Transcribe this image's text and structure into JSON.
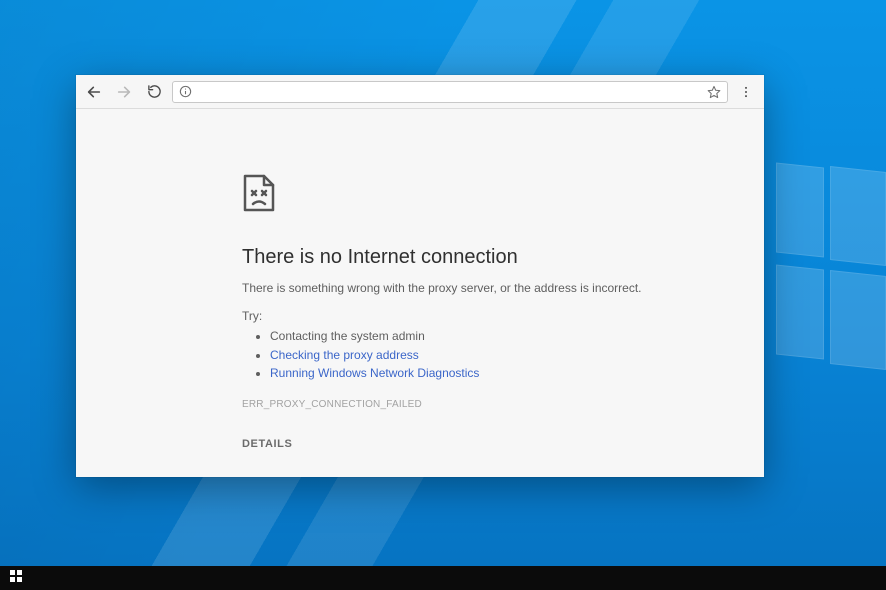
{
  "browser": {
    "toolbar": {
      "back_enabled": true,
      "forward_enabled": false,
      "address_value": "",
      "address_placeholder": ""
    },
    "error": {
      "heading": "There is no Internet connection",
      "description": "There is something wrong with the proxy server, or the address is incorrect.",
      "try_label": "Try:",
      "suggestions": [
        {
          "text": "Contacting the system admin",
          "link": false
        },
        {
          "text": "Checking the proxy address",
          "link": true
        },
        {
          "text": "Running Windows Network Diagnostics",
          "link": true
        }
      ],
      "error_code": "ERR_PROXY_CONNECTION_FAILED",
      "details_label": "DETAILS"
    }
  },
  "icons": {
    "back": "back-arrow",
    "forward": "forward-arrow",
    "reload": "reload",
    "info": "info-circle",
    "star": "star-outline",
    "menu": "vertical-dots",
    "sad_page": "sad-page",
    "start": "windows-logo"
  }
}
